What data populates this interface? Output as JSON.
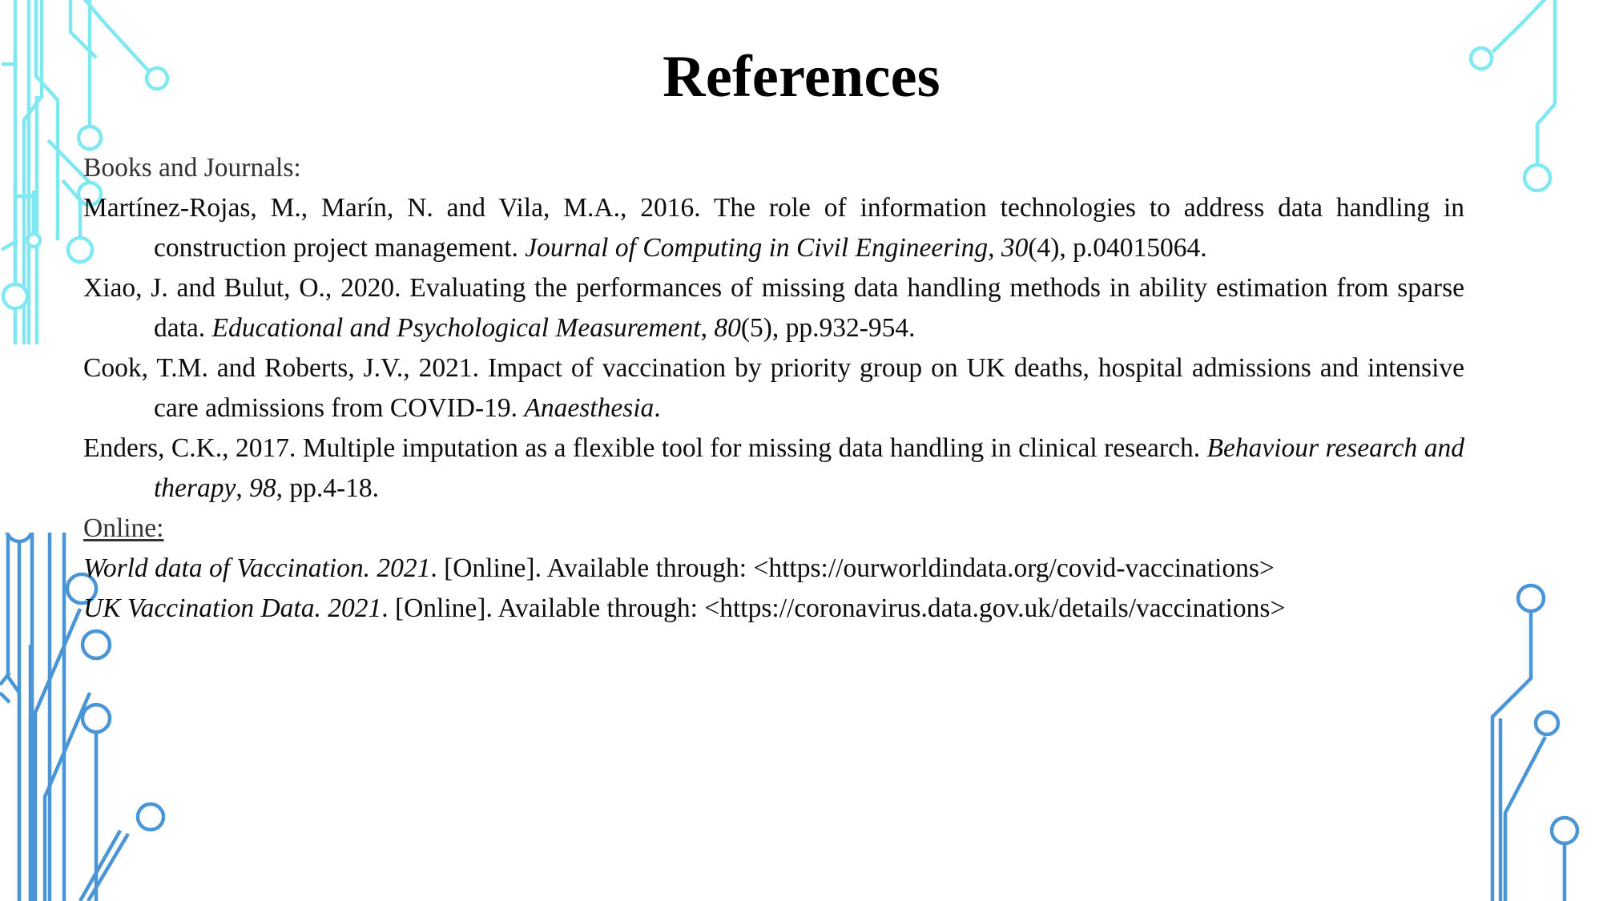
{
  "slide": {
    "title": "References",
    "background_color": "#ffffff",
    "text_color": "#0d0d0d"
  },
  "decor": {
    "top_accent_color": "#7fe8f0",
    "bottom_accent_color": "#4a95d6",
    "motif": "circuit-board-traces-with-node-circles"
  },
  "sections": [
    {
      "label": "Books and Journals:",
      "underlined": false,
      "entries": [
        {
          "parts": [
            {
              "text": "Martínez-Rojas, M., Marín, N. and Vila, M.A., 2016. The role of information technologies to address data handling in construction project management. ",
              "italic": false
            },
            {
              "text": "Journal of Computing in Civil Engineering, 30",
              "italic": true
            },
            {
              "text": "(4), p.04015064.",
              "italic": false
            }
          ]
        },
        {
          "parts": [
            {
              "text": "Xiao, J. and Bulut, O., 2020. Evaluating the performances of missing data handling methods in ability estimation from sparse data. ",
              "italic": false
            },
            {
              "text": "Educational and Psychological Measurement",
              "italic": true
            },
            {
              "text": ", ",
              "italic": false
            },
            {
              "text": "80",
              "italic": true
            },
            {
              "text": "(5), pp.932-954.",
              "italic": false
            }
          ]
        },
        {
          "parts": [
            {
              "text": "Cook, T.M. and Roberts, J.V., 2021. Impact of vaccination by priority group on UK deaths, hospital admissions and intensive care admissions from COVID-19. ",
              "italic": false
            },
            {
              "text": "Anaesthesia",
              "italic": true
            },
            {
              "text": ".",
              "italic": false
            }
          ]
        },
        {
          "parts": [
            {
              "text": "Enders, C.K., 2017. Multiple imputation as a flexible tool for missing data handling in clinical research. ",
              "italic": false
            },
            {
              "text": "Behaviour research and therapy",
              "italic": true
            },
            {
              "text": ", ",
              "italic": false
            },
            {
              "text": "98",
              "italic": true
            },
            {
              "text": ", pp.4-18.",
              "italic": false
            }
          ]
        }
      ]
    },
    {
      "label": "Online:",
      "underlined": true,
      "entries": [
        {
          "parts": [
            {
              "text": "World data of Vaccination. 2021",
              "italic": true
            },
            {
              "text": ". [Online]. Available through: <https://ourworldindata.org/covid-vaccinations>",
              "italic": false
            }
          ]
        },
        {
          "parts": [
            {
              "text": "UK Vaccination Data. 2021",
              "italic": true
            },
            {
              "text": ". [Online]. Available through: <https://coronavirus.data.gov.uk/details/vaccinations>",
              "italic": false
            }
          ]
        }
      ]
    }
  ]
}
